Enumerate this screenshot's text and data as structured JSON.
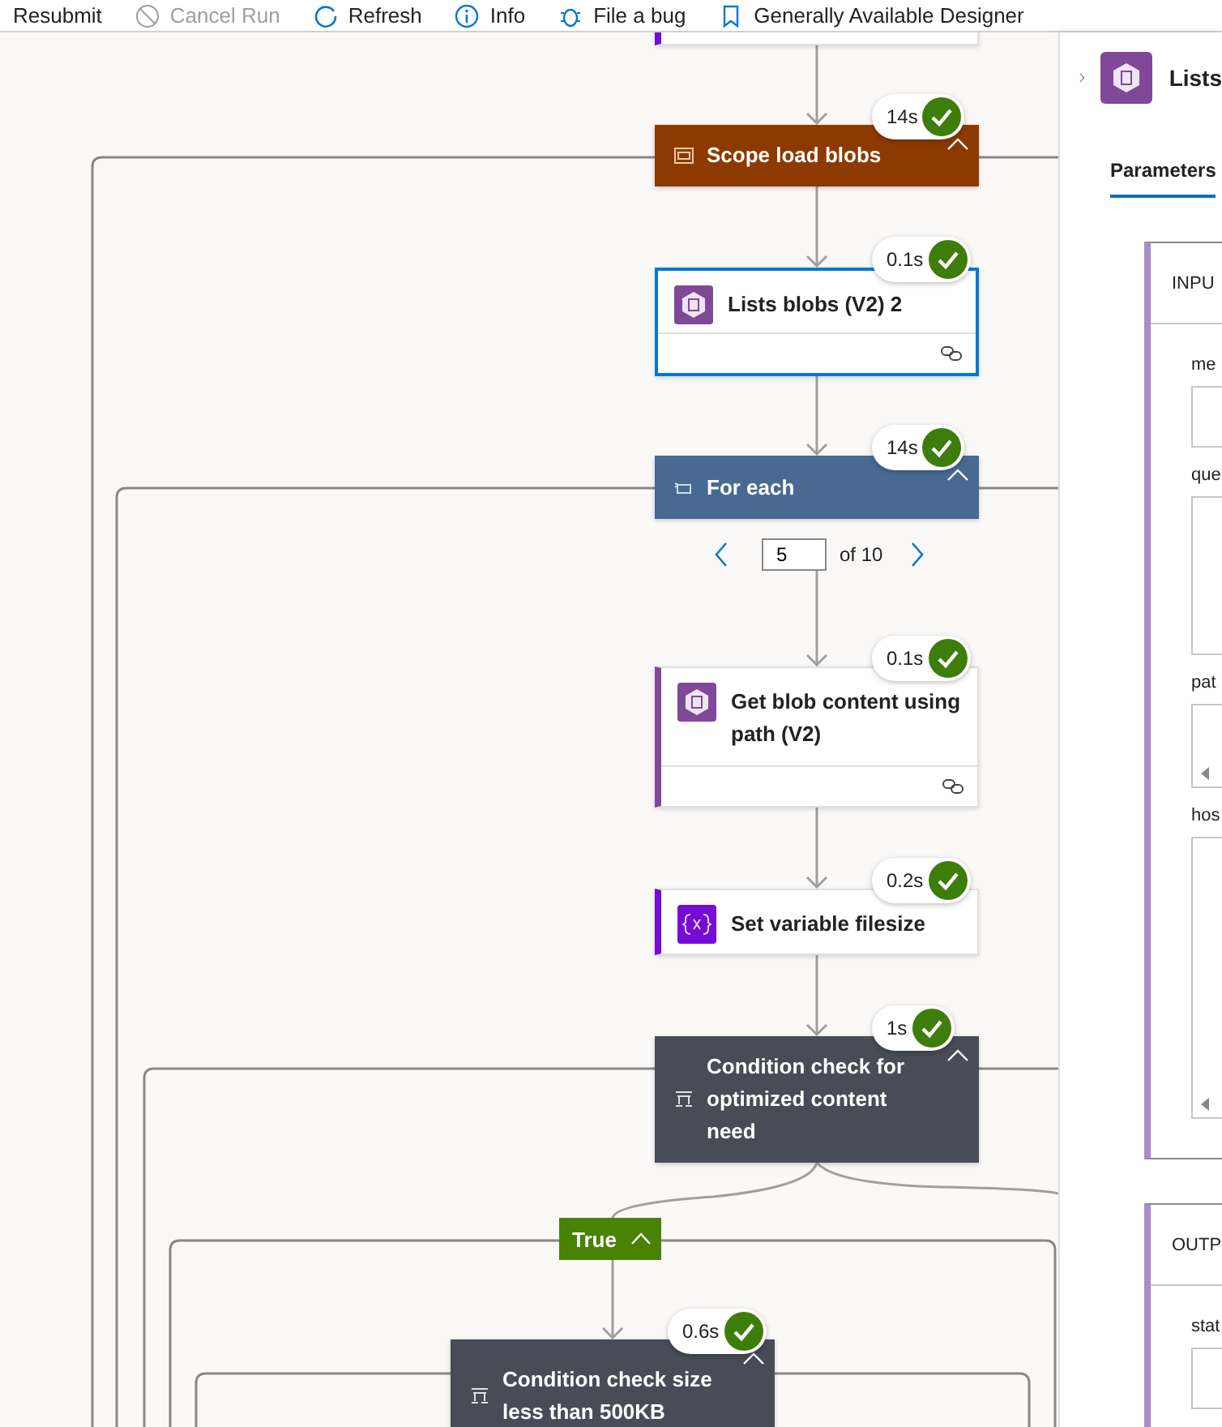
{
  "toolbar": [
    {
      "kind": "resubmit",
      "label": "Resubmit",
      "disabled": false
    },
    {
      "kind": "cancel",
      "label": "Cancel Run",
      "disabled": true
    },
    {
      "kind": "refresh",
      "label": "Refresh",
      "disabled": false
    },
    {
      "kind": "info",
      "label": "Info",
      "disabled": false
    },
    {
      "kind": "bug",
      "label": "File a bug",
      "disabled": false
    },
    {
      "kind": "designer",
      "label": "Generally Available Designer",
      "disabled": false
    }
  ],
  "nodes": [
    {
      "kind": "scope",
      "title": "Scope load blobs",
      "duration": "14s",
      "succeeded": true,
      "expanded": true
    },
    {
      "kind": "connector",
      "title": "Lists blobs (V2) 2",
      "duration": "0.1s",
      "succeeded": true,
      "selected": true
    },
    {
      "kind": "foreach",
      "title": "For each",
      "duration": "14s",
      "succeeded": true,
      "expanded": true
    },
    {
      "kind": "connector",
      "title": "Get blob content using path (V2)",
      "duration": "0.1s",
      "succeeded": true,
      "selected": false
    },
    {
      "kind": "variable",
      "title": "Set variable filesize",
      "duration": "0.2s",
      "succeeded": true,
      "selected": false
    },
    {
      "kind": "condition",
      "title": "Condition check for optimized content need",
      "duration": "1s",
      "succeeded": true,
      "expanded": true
    },
    {
      "kind": "condition",
      "title": "Condition check size less than 500KB",
      "duration": "0.6s",
      "succeeded": true,
      "expanded": true
    }
  ],
  "pager": {
    "value": "5",
    "total": "of 10"
  },
  "branch": {
    "label": "True",
    "expanded": true
  },
  "panel": {
    "title": "Lists",
    "tabs": [
      {
        "label": "Parameters",
        "selected": true
      }
    ],
    "sections": [
      {
        "title": "INPU",
        "fields": [
          {
            "label": "me",
            "kind": "line"
          },
          {
            "label": "que",
            "kind": "area"
          },
          {
            "label": "pat",
            "kind": "scroll"
          },
          {
            "label": "hos",
            "kind": "scrollarea"
          }
        ]
      },
      {
        "title": "OUTP",
        "fields": [
          {
            "label": "stat",
            "kind": "line"
          }
        ]
      }
    ]
  }
}
